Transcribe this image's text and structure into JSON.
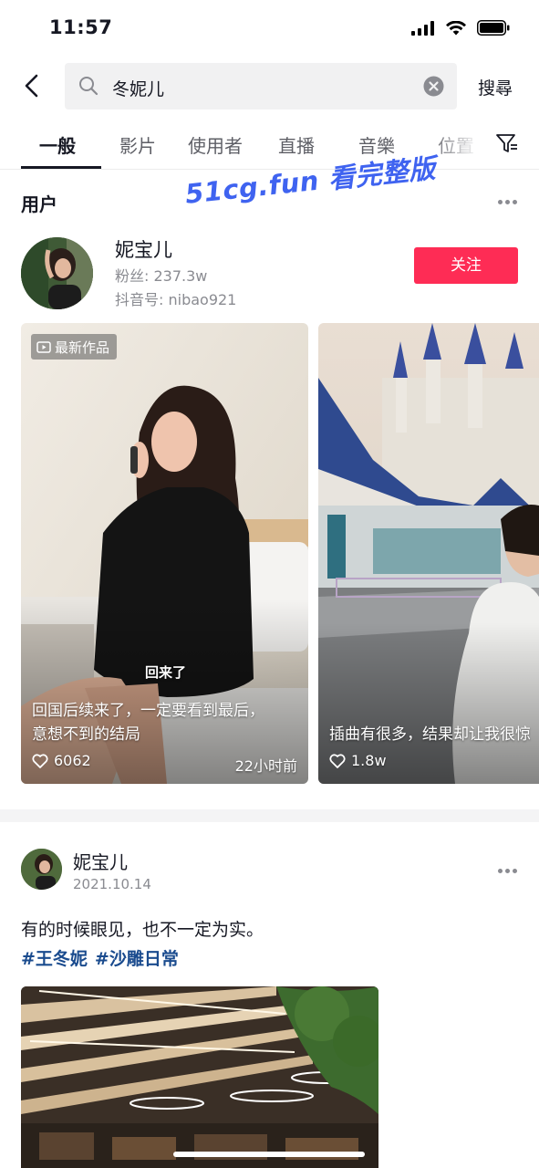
{
  "status_bar": {
    "time": "11:57"
  },
  "search": {
    "query": "冬妮儿",
    "action_label": "搜尋"
  },
  "tabs": [
    {
      "label": "一般",
      "active": true
    },
    {
      "label": "影片",
      "active": false
    },
    {
      "label": "使用者",
      "active": false
    },
    {
      "label": "直播",
      "active": false
    },
    {
      "label": "音樂",
      "active": false
    },
    {
      "label": "位置",
      "active": false
    }
  ],
  "users_section": {
    "title": "用户"
  },
  "watermark": "51cg.fun 看完整版",
  "user": {
    "name": "妮宝儿",
    "followers": "粉丝: 237.3w",
    "douyin_id": "抖音号: nibao921",
    "follow_label": "关注"
  },
  "videos": [
    {
      "badge": "最新作品",
      "subtitle": "回来了",
      "caption_line1": "回国后续来了，一定要看到最后，",
      "caption_line2": "意想不到的结局",
      "likes": "6062",
      "time": "22小时前"
    },
    {
      "caption_line1": "插曲有很多，结果却让我很惊",
      "likes": "1.8w"
    }
  ],
  "post": {
    "author": "妮宝儿",
    "date": "2021.10.14",
    "text": "有的时候眼见，也不一定为实。",
    "tags": [
      "#王冬妮",
      "#沙雕日常"
    ]
  },
  "colors": {
    "accent": "#fe2c55",
    "hashtag": "#1a4b8e",
    "watermark": "#3f63f0"
  }
}
